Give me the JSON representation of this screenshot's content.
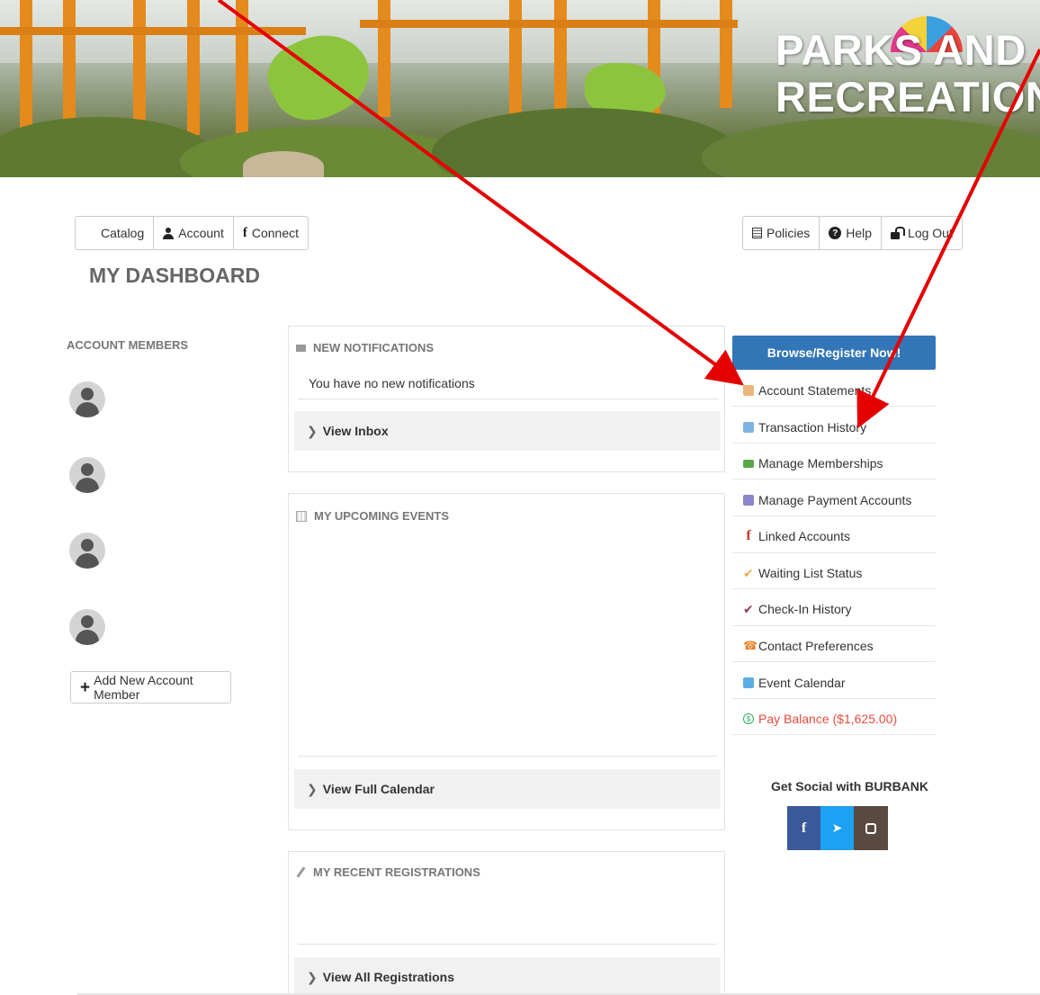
{
  "banner": {
    "title_line1": "PARKS AND",
    "title_line2": "RECREATION"
  },
  "nav_left": [
    {
      "label": "Catalog",
      "icon": "grid-icon"
    },
    {
      "label": "Account",
      "icon": "user-icon"
    },
    {
      "label": "Connect",
      "icon": "facebook-icon"
    }
  ],
  "nav_right": [
    {
      "label": "Policies",
      "icon": "document-icon"
    },
    {
      "label": "Help",
      "icon": "question-circle-icon"
    },
    {
      "label": "Log Out",
      "icon": "unlock-icon"
    }
  ],
  "page_title": "MY DASHBOARD",
  "members": {
    "heading": "ACCOUNT MEMBERS",
    "count": 4,
    "add_label": "Add New Account Member"
  },
  "notifications": {
    "heading": "NEW NOTIFICATIONS",
    "message": "You have no new notifications",
    "link": "View Inbox"
  },
  "events": {
    "heading": "MY UPCOMING EVENTS",
    "link": "View Full Calendar"
  },
  "registrations": {
    "heading": "MY RECENT REGISTRATIONS",
    "link": "View All Registrations"
  },
  "sidebar": {
    "browse_label": "Browse/Register Now!",
    "items": [
      {
        "label": "Account Statements",
        "icon": "statement-icon",
        "color": "#e8b77c"
      },
      {
        "label": "Transaction History",
        "icon": "history-icon",
        "color": "#7fb3df"
      },
      {
        "label": "Manage Memberships",
        "icon": "membership-card-icon",
        "color": "#5aa84a"
      },
      {
        "label": "Manage Payment Accounts",
        "icon": "payment-icon",
        "color": "#8a86c9"
      },
      {
        "label": "Linked Accounts",
        "icon": "facebook-icon",
        "color": "#c0392b"
      },
      {
        "label": "Waiting List Status",
        "icon": "check-icon",
        "color": "#f0ad4e"
      },
      {
        "label": "Check-In History",
        "icon": "check-icon",
        "color": "#9b3a5a"
      },
      {
        "label": "Contact Preferences",
        "icon": "phone-icon",
        "color": "#e67e22"
      },
      {
        "label": "Event Calendar",
        "icon": "calendar-icon",
        "color": "#5dade2"
      },
      {
        "label": "Pay Balance ($1,625.00)",
        "icon": "dollar-circle-icon",
        "color": "#e74c3c"
      }
    ]
  },
  "social": {
    "heading": "Get Social with BURBANK",
    "colors": {
      "facebook": "#3b5998",
      "twitter": "#1da1f2",
      "instagram": "#5b4a42"
    }
  },
  "colors": {
    "annotation_arrow": "#e50000",
    "primary_button": "#3276b8"
  }
}
